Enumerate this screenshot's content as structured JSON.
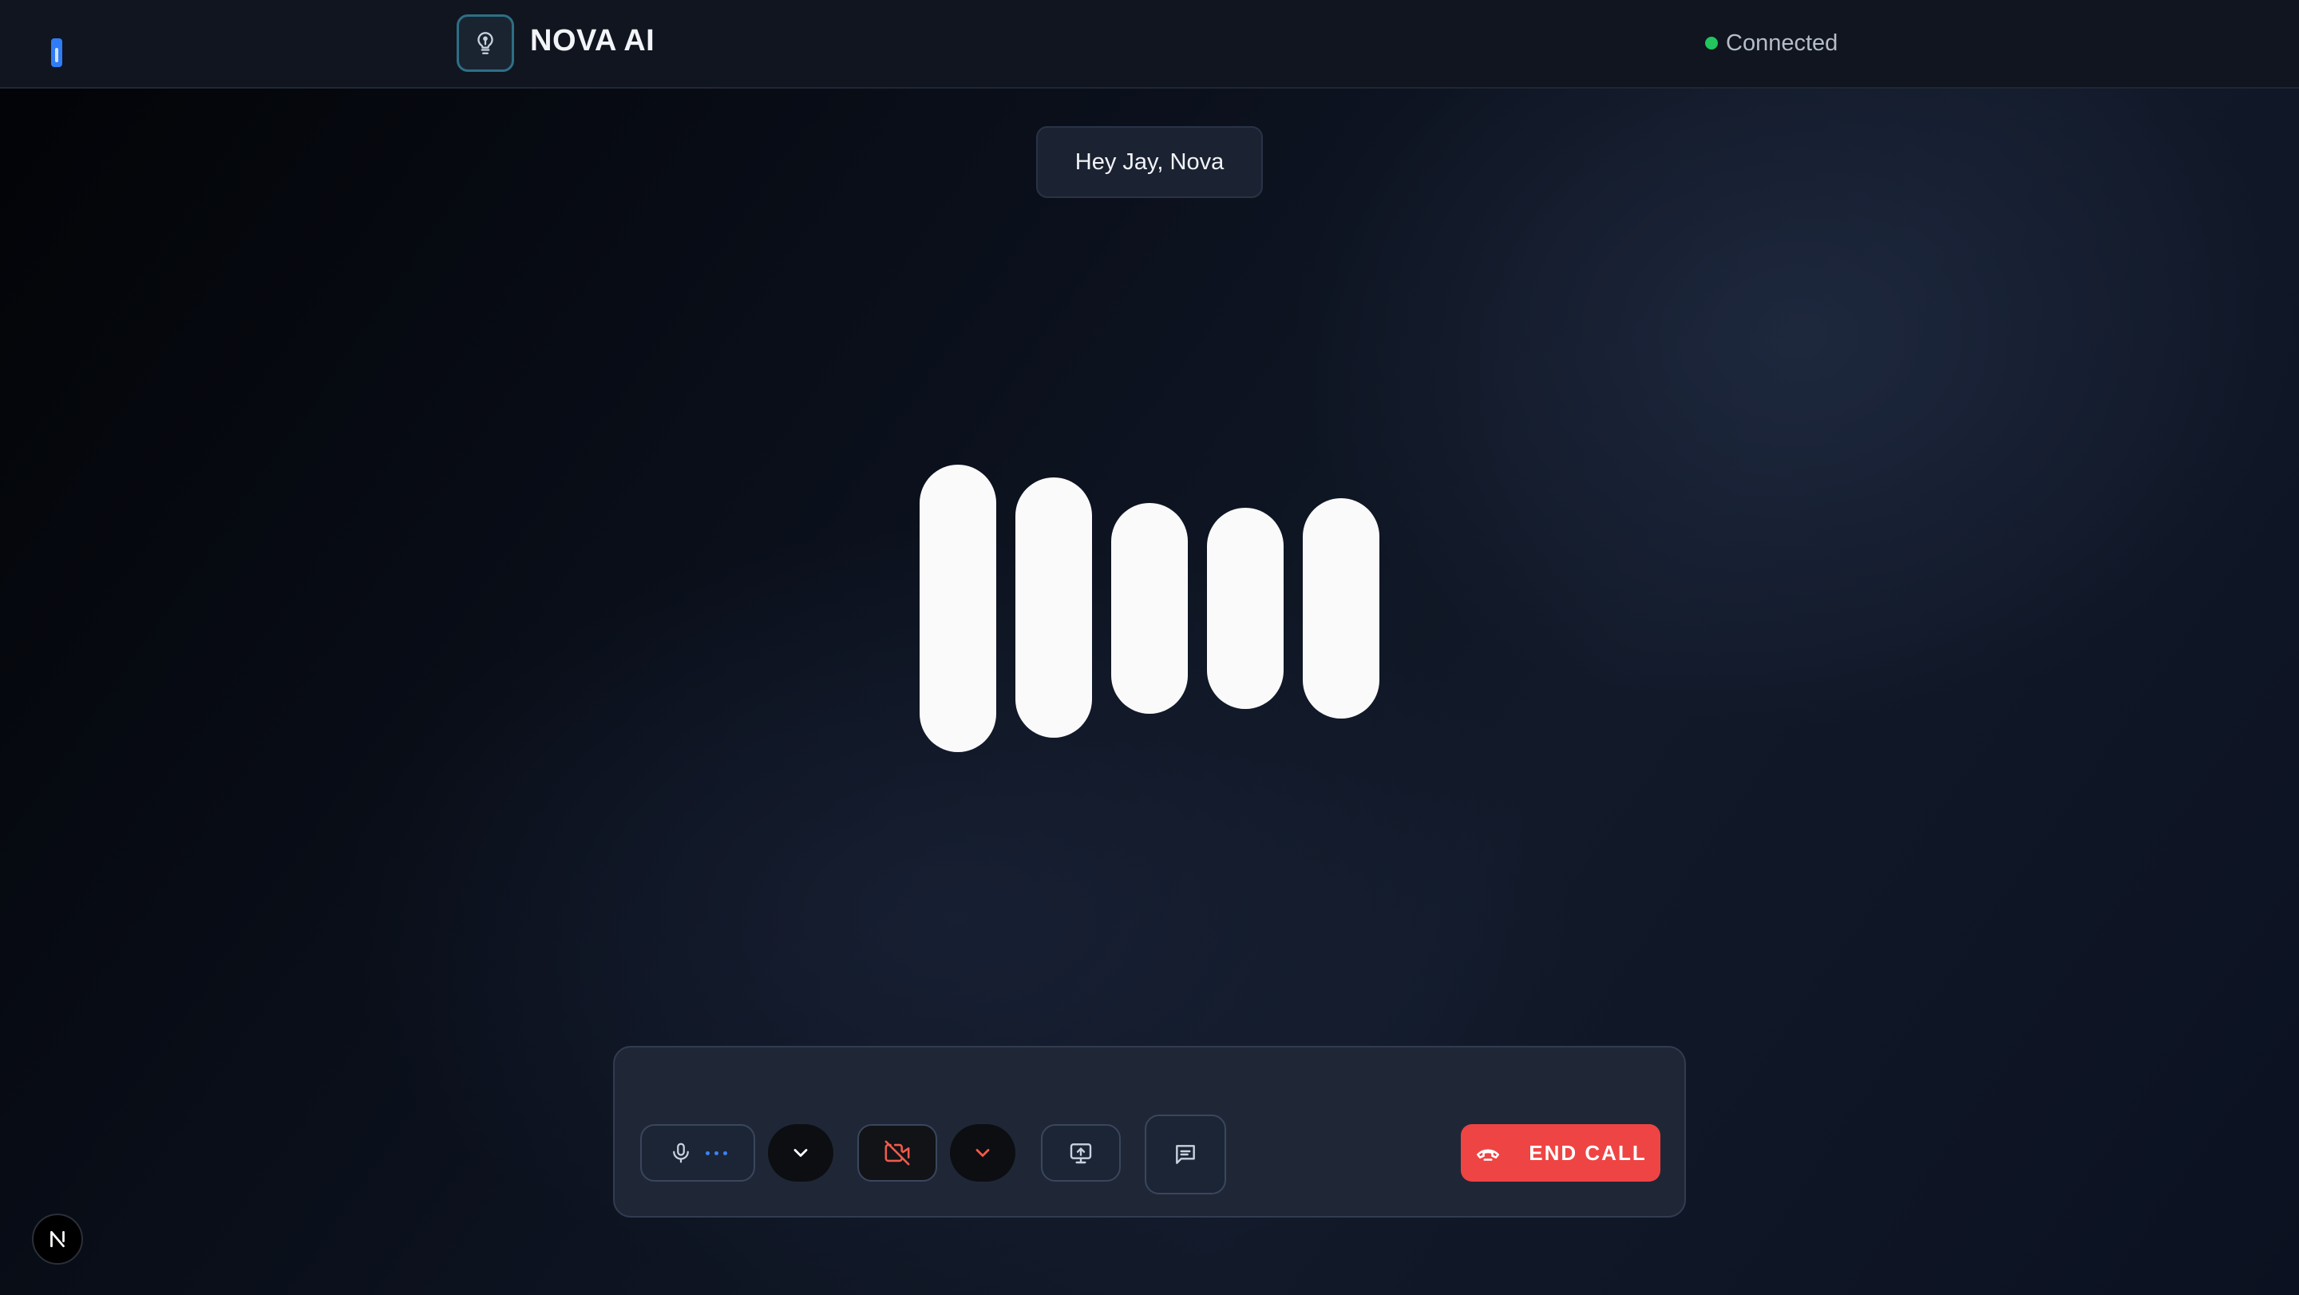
{
  "header": {
    "app_title": "NOVA AI",
    "logo_icon": "lightbulb-icon",
    "status": {
      "text": "Connected",
      "color": "#22c55e"
    }
  },
  "greeting": {
    "text": "Hey Jay, Nova"
  },
  "visualizer": {
    "bar_color": "#fafafa",
    "bar_count": 5
  },
  "controls": {
    "mic": {
      "icon": "microphone-icon",
      "indicator": "audio-activity-dots"
    },
    "mic_dropdown": {
      "icon": "chevron-down-icon"
    },
    "camera": {
      "icon": "camera-off-icon",
      "state": "off",
      "color": "#ef4444"
    },
    "camera_dropdown": {
      "icon": "chevron-down-icon"
    },
    "share_screen": {
      "icon": "screen-share-icon"
    },
    "chat": {
      "icon": "chat-icon"
    },
    "end_call": {
      "label": "END CALL",
      "icon": "phone-hangup-icon",
      "color": "#ef4444"
    }
  },
  "footer": {
    "badge_icon": "n-logo-icon"
  },
  "colors": {
    "accent": "#3b82f6",
    "danger": "#ef4444",
    "success": "#22c55e",
    "panel": "#1f2737"
  }
}
